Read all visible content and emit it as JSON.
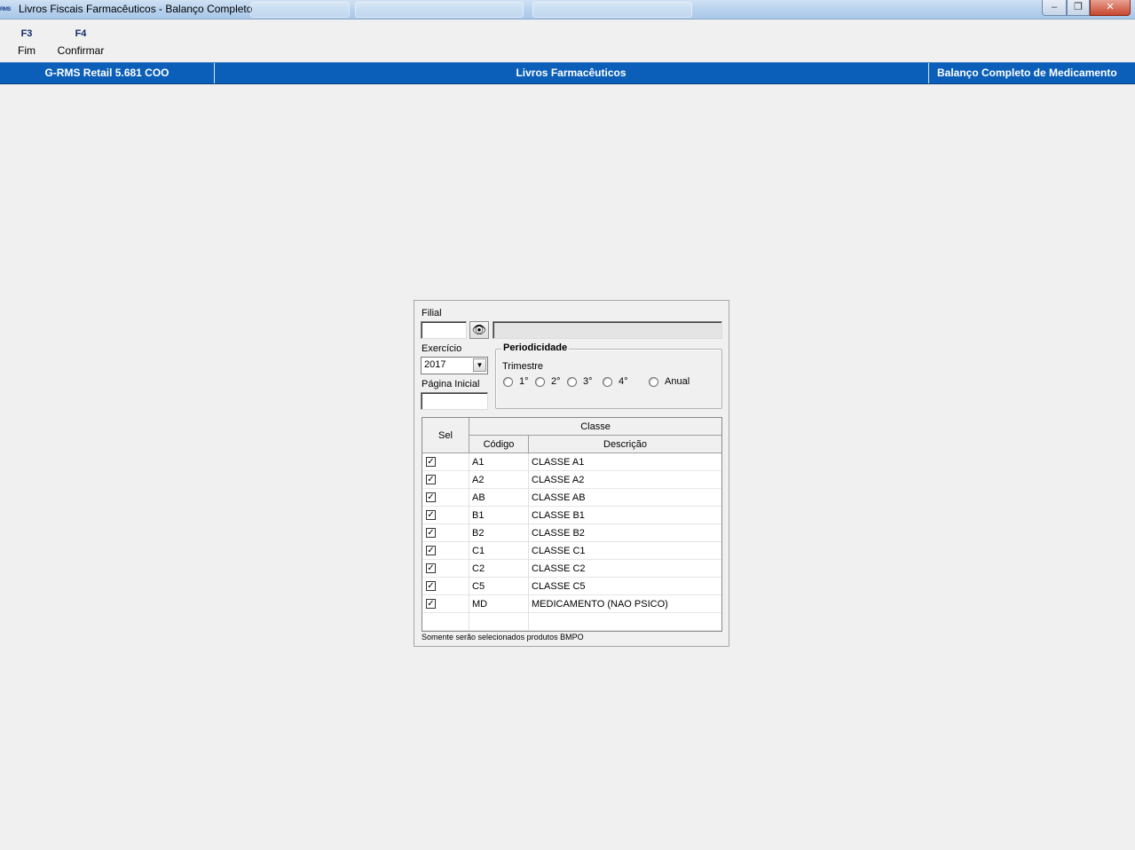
{
  "window": {
    "icon_text": "RMS",
    "title": "Livros Fiscais Farmacêuticos - Balanço Completo",
    "controls": {
      "minimize": "–",
      "maximize": "❐",
      "close": "✕"
    }
  },
  "function_keys": [
    {
      "key": "F3",
      "label": "Fim"
    },
    {
      "key": "F4",
      "label": "Confirmar"
    }
  ],
  "header_bar": {
    "system": "G-RMS Retail 5.681 COO",
    "module": "Livros Farmacêuticos",
    "screen": "Balanço Completo de Medicamento"
  },
  "form": {
    "filial_label": "Filial",
    "filial_value": "",
    "filial_description": "",
    "search_icon": "binoculars-icon",
    "exercicio_label": "Exercício",
    "exercicio_value": "2017",
    "pagina_label": "Página Inicial",
    "pagina_value": "",
    "periodicidade": {
      "legend": "Periodicidade",
      "trimestre_label": "Trimestre",
      "options": [
        "1°",
        "2°",
        "3°",
        "4°",
        "Anual"
      ]
    }
  },
  "grid": {
    "headers": {
      "sel": "Sel",
      "classe": "Classe",
      "codigo": "Código",
      "descricao": "Descrição"
    },
    "rows": [
      {
        "checked": true,
        "codigo": "A1",
        "descricao": "CLASSE A1"
      },
      {
        "checked": true,
        "codigo": "A2",
        "descricao": "CLASSE A2"
      },
      {
        "checked": true,
        "codigo": "AB",
        "descricao": "CLASSE AB"
      },
      {
        "checked": true,
        "codigo": "B1",
        "descricao": "CLASSE B1"
      },
      {
        "checked": true,
        "codigo": "B2",
        "descricao": "CLASSE B2"
      },
      {
        "checked": true,
        "codigo": "C1",
        "descricao": "CLASSE C1"
      },
      {
        "checked": true,
        "codigo": "C2",
        "descricao": "CLASSE C2"
      },
      {
        "checked": true,
        "codigo": "C5",
        "descricao": "CLASSE C5"
      },
      {
        "checked": true,
        "codigo": "MD",
        "descricao": "MEDICAMENTO (NAO PSICO)"
      }
    ]
  },
  "note": "Somente serão selecionados produtos BMPO",
  "colors": {
    "header_blue": "#0b5fb8",
    "background": "#f0f0f0"
  }
}
